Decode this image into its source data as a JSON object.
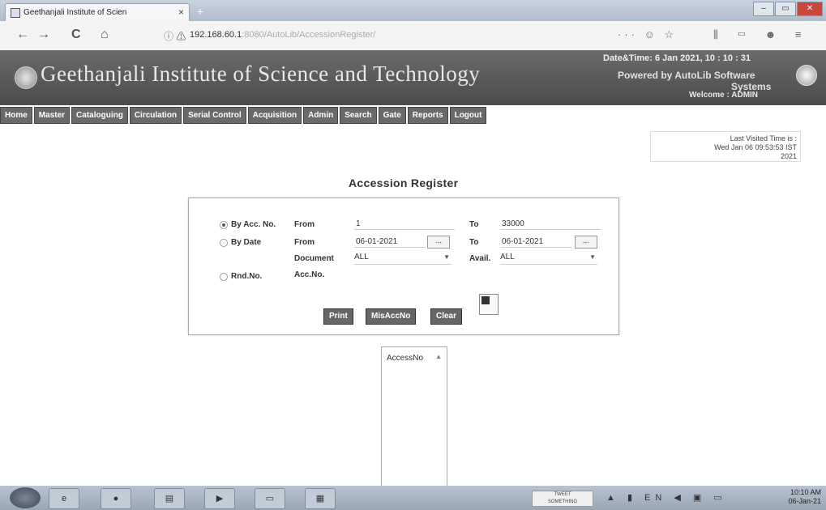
{
  "browser": {
    "tab_title": "Geethanjali Institute of Scien",
    "tab_close": "×",
    "new_tab": "+",
    "url_main": "192.168.60.1",
    "url_rest": ":8080/AutoLib/AccessionRegister/",
    "page_actions": "··· ☺ ☆",
    "toolbar_right": "⫼ ▭ ☻ ≡",
    "window_controls": [
      "–",
      "▭",
      "✕"
    ],
    "nav_icons": [
      "←",
      "→",
      "C",
      "⌂"
    ]
  },
  "header": {
    "site_title": "Geethanjali Institute of Science and Technology",
    "datetime_label": "Date&Time:",
    "datetime_value": "6 Jan 2021, 10 : 10 : 31",
    "powered_by": "Powered by AutoLib Software",
    "powered_by_2": "Systems",
    "welcome_label": "Welcome",
    "welcome_user": ": ADMIN"
  },
  "menu": [
    "Home",
    "Master",
    "Cataloguing",
    "Circulation",
    "Serial Control",
    "Acquisition",
    "Admin",
    "Search",
    "Gate",
    "Reports",
    "Logout"
  ],
  "last_visit": {
    "line1": "Last Visited Time is :",
    "line2": "Wed Jan 06 09:53:53 IST",
    "line3": "2021"
  },
  "page_title": "Accession Register",
  "form": {
    "by_acc_label": "By Acc. No.",
    "by_date_label": "By Date",
    "rnd_label": "Rnd.No.",
    "from_label": "From",
    "from_label2": "From",
    "to_label": "To",
    "to_label2": "To",
    "document_label": "Document",
    "avail_label": "Avail.",
    "accno_label": "Acc.No.",
    "acc_from_value": "1",
    "acc_to_value": "33000",
    "date_from_value": "06-01-2021",
    "date_to_value": "06-01-2021",
    "picker_label": "...",
    "document_value": "ALL",
    "avail_value": "ALL",
    "selected_mode": "By Acc. No."
  },
  "buttons": {
    "print": "Print",
    "misaccno": "MisAccNo",
    "clear": "Clear"
  },
  "list": {
    "header": "AccessNo"
  },
  "taskbar": {
    "tray_text_1": "TWEET",
    "tray_text_2": "SOMETHING",
    "tray_icons": "▲ ▮ EN ◀ ▣ ▭",
    "time": "10:10 AM",
    "date": "06-Jan-21"
  }
}
